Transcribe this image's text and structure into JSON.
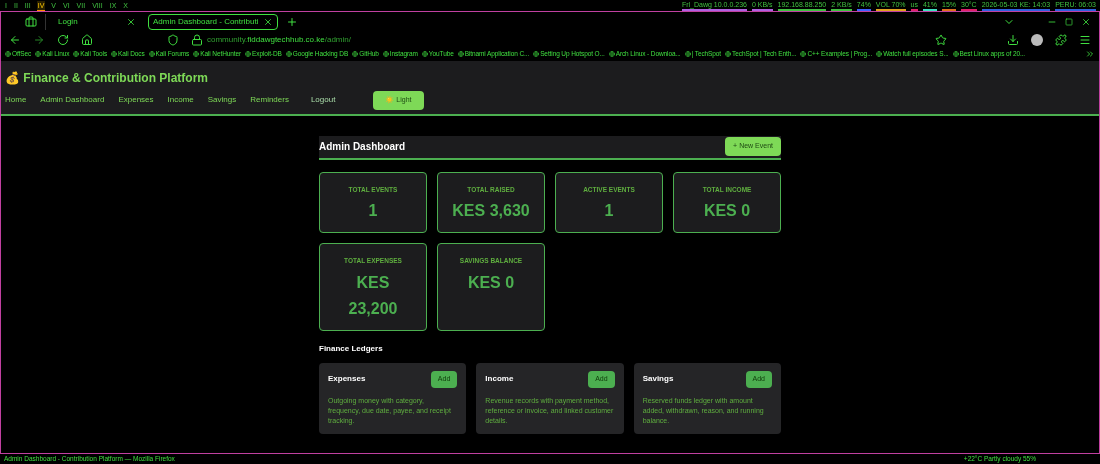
{
  "system_bar": {
    "workspaces": [
      {
        "label": "I",
        "selected": false
      },
      {
        "label": "II",
        "selected": false
      },
      {
        "label": "III",
        "selected": false
      },
      {
        "label": "IV",
        "selected": true
      },
      {
        "label": "V",
        "selected": false
      },
      {
        "label": "VI",
        "selected": false
      },
      {
        "label": "VII",
        "selected": false
      },
      {
        "label": "VIII",
        "selected": false
      },
      {
        "label": "IX",
        "selected": false
      },
      {
        "label": "X",
        "selected": false
      }
    ],
    "status": [
      {
        "text": "Frl_Dawg 10.0.0.236",
        "color": "#b060e0"
      },
      {
        "text": "0 KB/s",
        "color": "#b060e0"
      },
      {
        "text": "192.168.88.250",
        "color": "#40c040"
      },
      {
        "text": "2 KB/s",
        "color": "#40c040"
      },
      {
        "text": "74%",
        "color": "#4060ff"
      },
      {
        "text": "VOL 70%",
        "color": "#e0a020"
      },
      {
        "text": "us",
        "color": "#e0206a"
      },
      {
        "text": "41%",
        "color": "#40e0c0"
      },
      {
        "text": "15%",
        "color": "#e07020"
      },
      {
        "text": "30°C",
        "color": "#e0206a"
      },
      {
        "text": "2026-05-03 KE: 14:03",
        "color": "#3060e0"
      },
      {
        "text": "PERU: 06:03",
        "color": "#3060e0"
      }
    ]
  },
  "browser": {
    "tabs": [
      {
        "label": "Login",
        "selected": false
      },
      {
        "label": "Admin Dashboard - Contributi",
        "selected": true
      }
    ],
    "url": {
      "prefix": "community.",
      "domain": "fiddawgtechhub.co.ke",
      "path": "/admin/"
    },
    "bookmarks": [
      "OffSec",
      "Kali Linux",
      "Kali Tools",
      "Kali Docs",
      "Kali Forums",
      "Kali NetHunter",
      "Exploit-DB",
      "Google Hacking DB",
      "GitHub",
      "Instagram",
      "YouTube",
      "Bitnami Application C...",
      "Setting Up Hotspot O...",
      "Arch Linux - Downloa...",
      "| TechSpot",
      "TechSpot | Tech Enth...",
      "C++ Examples | Prog...",
      "Watch full episodes S...",
      "Best Linux apps of 20..."
    ]
  },
  "page": {
    "brand": "💰 Finance & Contribution Platform",
    "nav": [
      "Home",
      "Admin Dashboard",
      "Expenses",
      "Income",
      "Savings",
      "Reminders",
      "Logout"
    ],
    "theme_button": "☀️ Light",
    "heading": "Admin Dashboard",
    "new_event_button": "+ New Event",
    "stats": [
      {
        "label": "TOTAL EVENTS",
        "value": "1"
      },
      {
        "label": "TOTAL RAISED",
        "value": "KES 3,630"
      },
      {
        "label": "ACTIVE EVENTS",
        "value": "1"
      },
      {
        "label": "TOTAL INCOME",
        "value": "KES 0"
      },
      {
        "label": "TOTAL EXPENSES",
        "value": "KES 23,200"
      },
      {
        "label": "SAVINGS BALANCE",
        "value": "KES 0"
      }
    ],
    "ledgers_title": "Finance Ledgers",
    "ledgers": [
      {
        "title": "Expenses",
        "button": "Add",
        "description": "Outgoing money with category, frequency, due date, payee, and receipt tracking."
      },
      {
        "title": "Income",
        "button": "Add",
        "description": "Revenue records with payment method, reference or invoice, and linked customer details."
      },
      {
        "title": "Savings",
        "button": "Add",
        "description": "Reserved funds ledger with amount added, withdrawn, reason, and running balance."
      }
    ]
  },
  "status_bar": {
    "window_title": "Admin Dashboard - Contribution Platform — Mozilla Firefox",
    "weather": "+22°C Partly cloudy 55%"
  }
}
